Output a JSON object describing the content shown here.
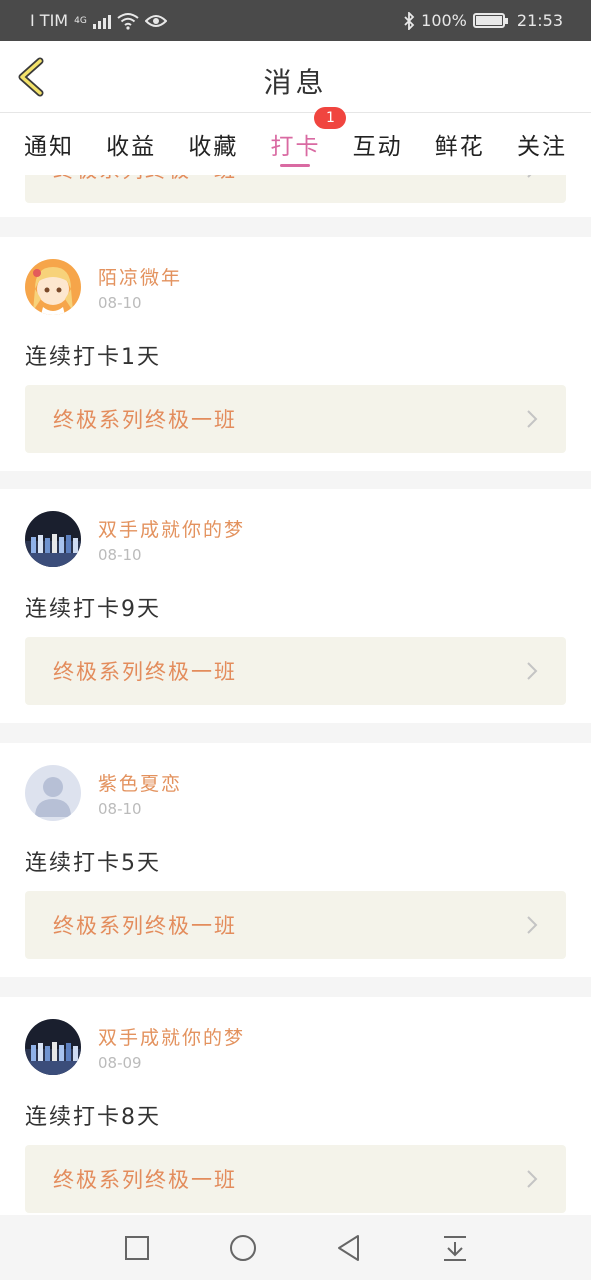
{
  "status_bar": {
    "carrier": "I TIM",
    "network": "4G",
    "battery": "100%",
    "time": "21:53"
  },
  "header": {
    "title": "消息",
    "back_icon": "chevron-left-icon"
  },
  "tabs": [
    {
      "label": "通知",
      "active": false
    },
    {
      "label": "收益",
      "active": false
    },
    {
      "label": "收藏",
      "active": false
    },
    {
      "label": "打卡",
      "active": true,
      "badge": "1"
    },
    {
      "label": "互动",
      "active": false
    },
    {
      "label": "鲜花",
      "active": false
    },
    {
      "label": "关注",
      "active": false
    }
  ],
  "colors": {
    "accent": "#d96aa2",
    "username": "#e3925e",
    "link_bg": "#f4f3ea",
    "link_text": "#e38c5c",
    "badge": "#f0453f"
  },
  "cards": [
    {
      "username": "陌凉微年",
      "date": "08-10",
      "content": "连续打卡1天",
      "link": "终极系列终极一班",
      "avatar": "anime-girl-avatar"
    },
    {
      "username": "双手成就你的梦",
      "date": "08-10",
      "content": "连续打卡9天",
      "link": "终极系列终极一班",
      "avatar": "group-photo-avatar"
    },
    {
      "username": "紫色夏恋",
      "date": "08-10",
      "content": "连续打卡5天",
      "link": "终极系列终极一班",
      "avatar": "default-avatar"
    },
    {
      "username": "双手成就你的梦",
      "date": "08-09",
      "content": "连续打卡8天",
      "link": "终极系列终极一班",
      "avatar": "group-photo-avatar"
    }
  ],
  "partial_link": "终极系列终极一班",
  "nav": {
    "recent": "square-icon",
    "home": "circle-icon",
    "back": "triangle-back-icon",
    "notifications": "pull-down-icon"
  }
}
